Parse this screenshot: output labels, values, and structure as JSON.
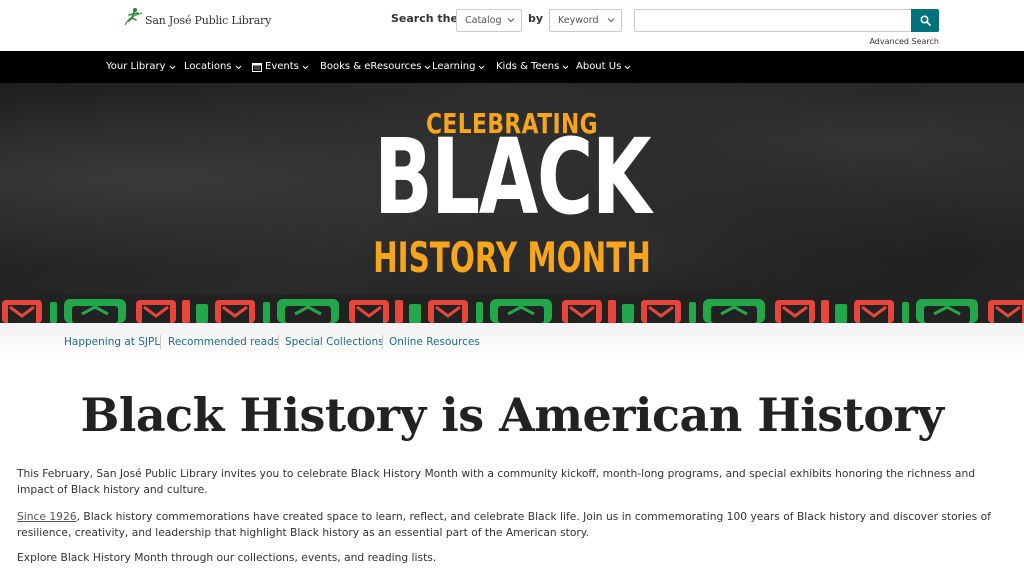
{
  "header": {
    "logo_text": "San José Public Library",
    "search_label": "Search the",
    "catalog_select": "Catalog",
    "by_label": "by",
    "keyword_select": "Keyword",
    "search_value": "",
    "advanced_search": "Advanced Search",
    "accent_color": "#00727b"
  },
  "nav": {
    "items": [
      {
        "label": "Your Library",
        "icon": null
      },
      {
        "label": "Locations",
        "icon": null
      },
      {
        "label": "Events",
        "icon": "calendar-icon"
      },
      {
        "label": "Books & eResources",
        "icon": null
      },
      {
        "label": "Learning",
        "icon": null
      },
      {
        "label": "Kids & Teens",
        "icon": null
      },
      {
        "label": "About Us",
        "icon": null
      }
    ]
  },
  "hero": {
    "line1": "CELEBRATING",
    "line2": "BLACK",
    "line3": "HISTORY MONTH",
    "accent_color": "#f7a51c"
  },
  "subnav": {
    "links": [
      "Happening at SJPL",
      "Recommended reads",
      "Special Collections",
      "Online Resources"
    ]
  },
  "main": {
    "title": "Black History is American History",
    "p1": "This February, San José Public Library invites you to celebrate Black History Month with a community kickoff, month-long programs, and special exhibits honoring the richness and impact of Black history and culture.",
    "p2_link": "Since 1926",
    "p2_rest": ", Black history commemorations have created space to learn, reflect, and celebrate Black life. Join us in commemorating 100 years of Black history and discover stories of resilience, creativity, and leadership that highlight Black history as an essential part of the American story.",
    "p3": "Explore Black History Month through our collections, events, and reading lists."
  }
}
